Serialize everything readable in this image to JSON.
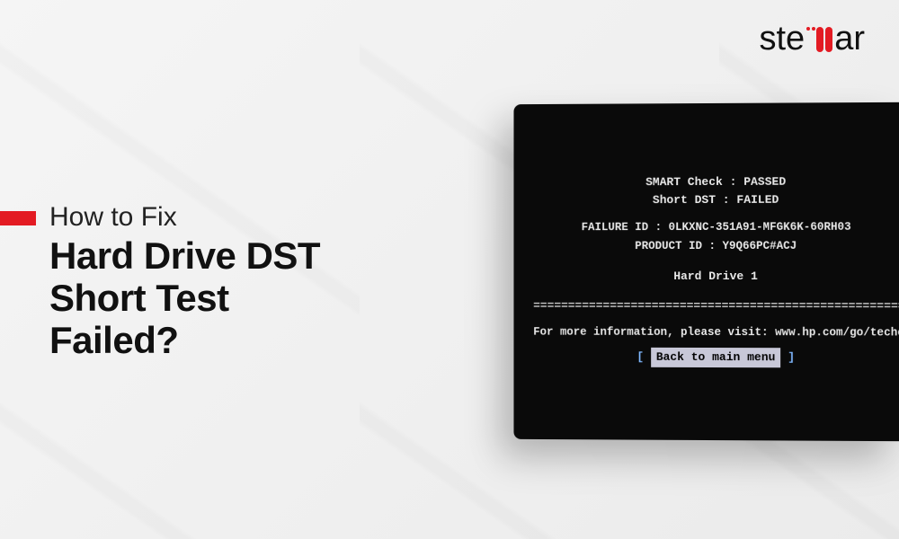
{
  "logo": {
    "text_before": "ste",
    "text_after": "ar"
  },
  "title": {
    "subtitle": "How to Fix",
    "line1": "Hard Drive DST",
    "line2": "Short Test",
    "line3": "Failed?"
  },
  "bios": {
    "smart_check": "SMART Check : PASSED",
    "short_dst": "Short DST : FAILED",
    "failure_id": "FAILURE ID : 0LKXNC-351A91-MFGK6K-60RH03",
    "product_id": "PRODUCT ID : Y9Q66PC#ACJ",
    "drive": "Hard Drive 1",
    "info": "For more information, please visit: www.hp.com/go/techcen",
    "button": "Back to main menu"
  }
}
